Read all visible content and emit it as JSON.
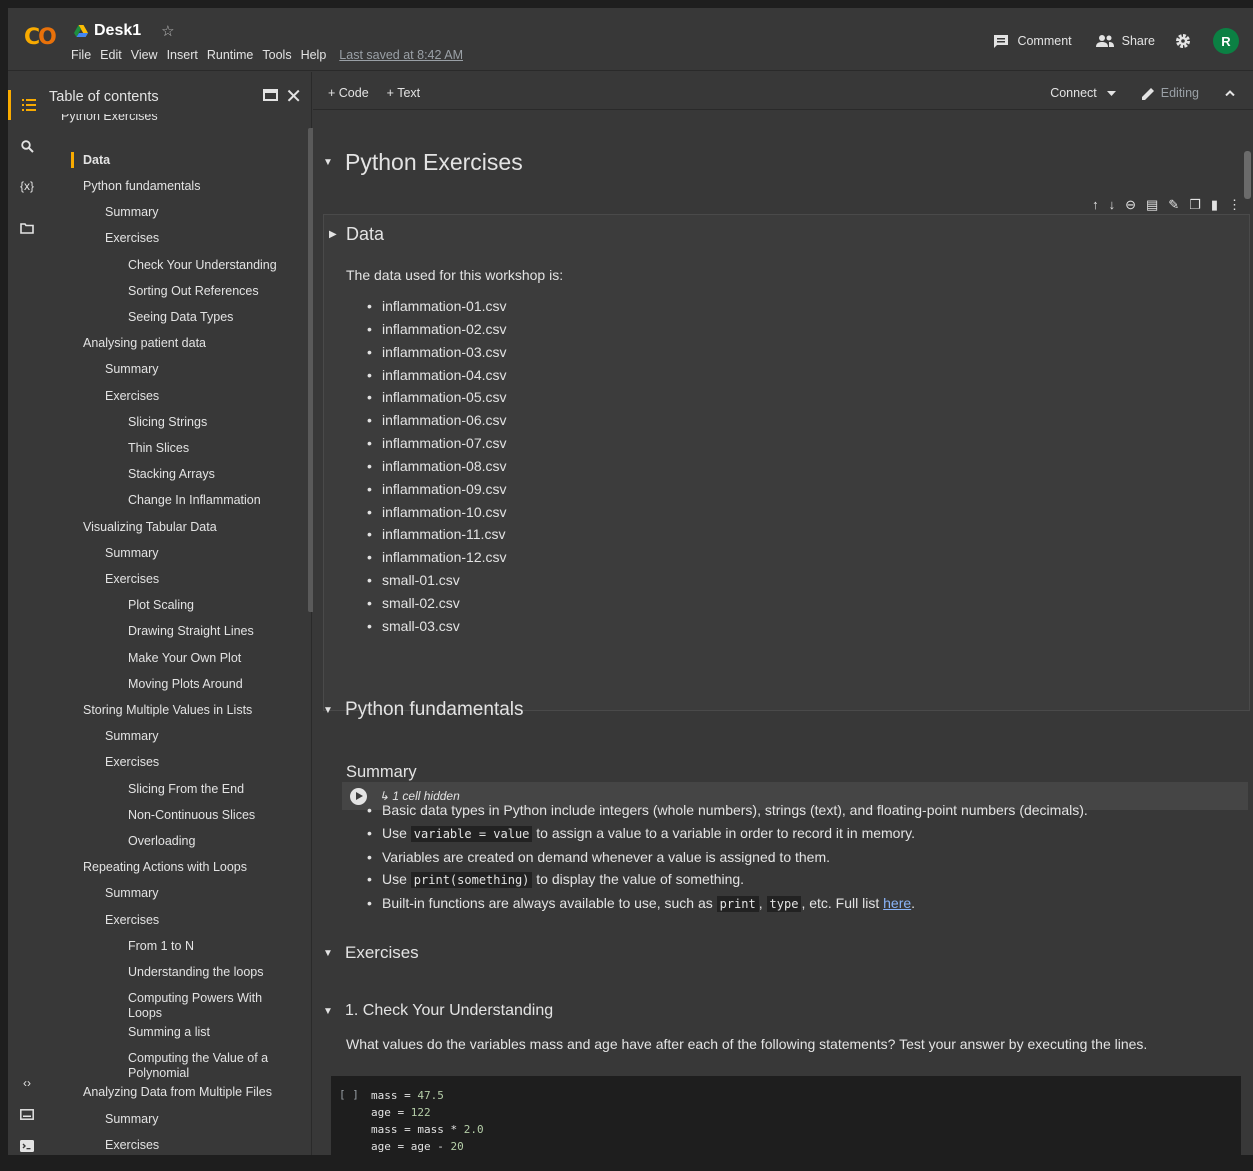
{
  "app": {
    "doc_title": "Desk1",
    "menu": [
      "File",
      "Edit",
      "View",
      "Insert",
      "Runtime",
      "Tools",
      "Help"
    ],
    "last_saved": "Last saved at 8:42 AM",
    "comment_label": "Comment",
    "share_label": "Share",
    "avatar_initial": "R"
  },
  "toolbar": {
    "add_code": "+ Code",
    "add_text": "+ Text",
    "connect": "Connect",
    "editing": "Editing"
  },
  "toc": {
    "title": "Table of contents",
    "items": [
      {
        "label": "Python Exercises",
        "level": 0
      },
      {
        "label": "Data",
        "level": 1,
        "active": true
      },
      {
        "label": "Python fundamentals",
        "level": 1
      },
      {
        "label": "Summary",
        "level": 2
      },
      {
        "label": "Exercises",
        "level": 2
      },
      {
        "label": "Check Your Understanding",
        "level": 3
      },
      {
        "label": "Sorting Out References",
        "level": 3
      },
      {
        "label": "Seeing Data Types",
        "level": 3
      },
      {
        "label": "Analysing patient data",
        "level": 1
      },
      {
        "label": "Summary",
        "level": 2
      },
      {
        "label": "Exercises",
        "level": 2
      },
      {
        "label": "Slicing Strings",
        "level": 3
      },
      {
        "label": "Thin Slices",
        "level": 3
      },
      {
        "label": "Stacking Arrays",
        "level": 3
      },
      {
        "label": "Change In Inflammation",
        "level": 3
      },
      {
        "label": "Visualizing Tabular Data",
        "level": 1
      },
      {
        "label": "Summary",
        "level": 2
      },
      {
        "label": "Exercises",
        "level": 2
      },
      {
        "label": "Plot Scaling",
        "level": 3
      },
      {
        "label": "Drawing Straight Lines",
        "level": 3
      },
      {
        "label": "Make Your Own Plot",
        "level": 3
      },
      {
        "label": "Moving Plots Around",
        "level": 3
      },
      {
        "label": "Storing Multiple Values in Lists",
        "level": 1
      },
      {
        "label": "Summary",
        "level": 2
      },
      {
        "label": "Exercises",
        "level": 2
      },
      {
        "label": "Slicing From the End",
        "level": 3
      },
      {
        "label": "Non-Continuous Slices",
        "level": 3
      },
      {
        "label": "Overloading",
        "level": 3
      },
      {
        "label": "Repeating Actions with Loops",
        "level": 1
      },
      {
        "label": "Summary",
        "level": 2
      },
      {
        "label": "Exercises",
        "level": 2
      },
      {
        "label": "From 1 to N",
        "level": 3
      },
      {
        "label": "Understanding the loops",
        "level": 3
      },
      {
        "label": "Computing Powers With Loops",
        "level": 3
      },
      {
        "label": "Summing a list",
        "level": 3
      },
      {
        "label": "Computing the Value of a Polynomial",
        "level": 3
      },
      {
        "label": "Analyzing Data from Multiple Files",
        "level": 1
      },
      {
        "label": "Summary",
        "level": 2
      },
      {
        "label": "Exercises",
        "level": 2
      }
    ]
  },
  "notebook": {
    "h_python_exercises": "Python Exercises",
    "h_data": "Data",
    "data_intro": "The data used for this workshop is:",
    "files": [
      "inflammation-01.csv",
      "inflammation-02.csv",
      "inflammation-03.csv",
      "inflammation-04.csv",
      "inflammation-05.csv",
      "inflammation-06.csv",
      "inflammation-07.csv",
      "inflammation-08.csv",
      "inflammation-09.csv",
      "inflammation-10.csv",
      "inflammation-11.csv",
      "inflammation-12.csv",
      "small-01.csv",
      "small-02.csv",
      "small-03.csv"
    ],
    "hidden_cells": "↳ 1 cell hidden",
    "h_fundamentals": "Python fundamentals",
    "h_summary": "Summary",
    "summary": {
      "b1": "Basic data types in Python include integers (whole numbers), strings (text), and floating-point numbers (decimals).",
      "b2_pre": "Use ",
      "b2_code": "variable = value",
      "b2_post": " to assign a value to a variable in order to record it in memory.",
      "b3": "Variables are created on demand whenever a value is assigned to them.",
      "b4_pre": "Use ",
      "b4_code": "print(something)",
      "b4_post": " to display the value of something.",
      "b5_pre": "Built-in functions are always available to use, such as ",
      "b5_code1": "print",
      "b5_sep": ", ",
      "b5_code2": "type",
      "b5_post": ", etc. Full list ",
      "b5_link": "here",
      "b5_end": "."
    },
    "h_exercises": "Exercises",
    "h_check": "1. Check Your Understanding",
    "check_text": "What values do the variables mass and age have after each of the following statements? Test your answer by executing the lines.",
    "code_bracket": "[ ]",
    "code_lines": [
      {
        "pre": "mass = ",
        "num": "47.5",
        "post": ""
      },
      {
        "pre": "age = ",
        "num": "122",
        "post": ""
      },
      {
        "pre": "mass = mass * ",
        "num": "2.0",
        "post": ""
      },
      {
        "pre": "age = age - ",
        "num": "20",
        "post": ""
      }
    ]
  }
}
